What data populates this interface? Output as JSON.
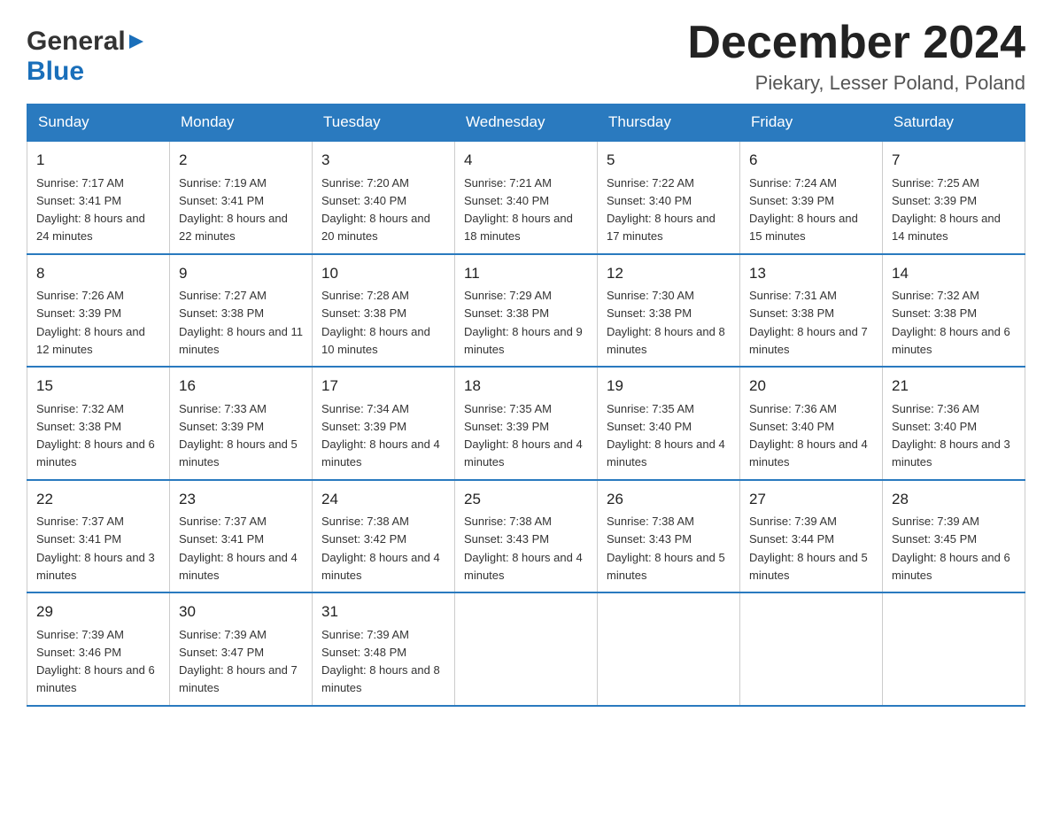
{
  "header": {
    "logo_general": "General",
    "logo_blue": "Blue",
    "month_title": "December 2024",
    "location": "Piekary, Lesser Poland, Poland"
  },
  "days_of_week": [
    "Sunday",
    "Monday",
    "Tuesday",
    "Wednesday",
    "Thursday",
    "Friday",
    "Saturday"
  ],
  "weeks": [
    [
      {
        "day": "1",
        "sunrise": "7:17 AM",
        "sunset": "3:41 PM",
        "daylight": "8 hours and 24 minutes."
      },
      {
        "day": "2",
        "sunrise": "7:19 AM",
        "sunset": "3:41 PM",
        "daylight": "8 hours and 22 minutes."
      },
      {
        "day": "3",
        "sunrise": "7:20 AM",
        "sunset": "3:40 PM",
        "daylight": "8 hours and 20 minutes."
      },
      {
        "day": "4",
        "sunrise": "7:21 AM",
        "sunset": "3:40 PM",
        "daylight": "8 hours and 18 minutes."
      },
      {
        "day": "5",
        "sunrise": "7:22 AM",
        "sunset": "3:40 PM",
        "daylight": "8 hours and 17 minutes."
      },
      {
        "day": "6",
        "sunrise": "7:24 AM",
        "sunset": "3:39 PM",
        "daylight": "8 hours and 15 minutes."
      },
      {
        "day": "7",
        "sunrise": "7:25 AM",
        "sunset": "3:39 PM",
        "daylight": "8 hours and 14 minutes."
      }
    ],
    [
      {
        "day": "8",
        "sunrise": "7:26 AM",
        "sunset": "3:39 PM",
        "daylight": "8 hours and 12 minutes."
      },
      {
        "day": "9",
        "sunrise": "7:27 AM",
        "sunset": "3:38 PM",
        "daylight": "8 hours and 11 minutes."
      },
      {
        "day": "10",
        "sunrise": "7:28 AM",
        "sunset": "3:38 PM",
        "daylight": "8 hours and 10 minutes."
      },
      {
        "day": "11",
        "sunrise": "7:29 AM",
        "sunset": "3:38 PM",
        "daylight": "8 hours and 9 minutes."
      },
      {
        "day": "12",
        "sunrise": "7:30 AM",
        "sunset": "3:38 PM",
        "daylight": "8 hours and 8 minutes."
      },
      {
        "day": "13",
        "sunrise": "7:31 AM",
        "sunset": "3:38 PM",
        "daylight": "8 hours and 7 minutes."
      },
      {
        "day": "14",
        "sunrise": "7:32 AM",
        "sunset": "3:38 PM",
        "daylight": "8 hours and 6 minutes."
      }
    ],
    [
      {
        "day": "15",
        "sunrise": "7:32 AM",
        "sunset": "3:38 PM",
        "daylight": "8 hours and 6 minutes."
      },
      {
        "day": "16",
        "sunrise": "7:33 AM",
        "sunset": "3:39 PM",
        "daylight": "8 hours and 5 minutes."
      },
      {
        "day": "17",
        "sunrise": "7:34 AM",
        "sunset": "3:39 PM",
        "daylight": "8 hours and 4 minutes."
      },
      {
        "day": "18",
        "sunrise": "7:35 AM",
        "sunset": "3:39 PM",
        "daylight": "8 hours and 4 minutes."
      },
      {
        "day": "19",
        "sunrise": "7:35 AM",
        "sunset": "3:40 PM",
        "daylight": "8 hours and 4 minutes."
      },
      {
        "day": "20",
        "sunrise": "7:36 AM",
        "sunset": "3:40 PM",
        "daylight": "8 hours and 4 minutes."
      },
      {
        "day": "21",
        "sunrise": "7:36 AM",
        "sunset": "3:40 PM",
        "daylight": "8 hours and 3 minutes."
      }
    ],
    [
      {
        "day": "22",
        "sunrise": "7:37 AM",
        "sunset": "3:41 PM",
        "daylight": "8 hours and 3 minutes."
      },
      {
        "day": "23",
        "sunrise": "7:37 AM",
        "sunset": "3:41 PM",
        "daylight": "8 hours and 4 minutes."
      },
      {
        "day": "24",
        "sunrise": "7:38 AM",
        "sunset": "3:42 PM",
        "daylight": "8 hours and 4 minutes."
      },
      {
        "day": "25",
        "sunrise": "7:38 AM",
        "sunset": "3:43 PM",
        "daylight": "8 hours and 4 minutes."
      },
      {
        "day": "26",
        "sunrise": "7:38 AM",
        "sunset": "3:43 PM",
        "daylight": "8 hours and 5 minutes."
      },
      {
        "day": "27",
        "sunrise": "7:39 AM",
        "sunset": "3:44 PM",
        "daylight": "8 hours and 5 minutes."
      },
      {
        "day": "28",
        "sunrise": "7:39 AM",
        "sunset": "3:45 PM",
        "daylight": "8 hours and 6 minutes."
      }
    ],
    [
      {
        "day": "29",
        "sunrise": "7:39 AM",
        "sunset": "3:46 PM",
        "daylight": "8 hours and 6 minutes."
      },
      {
        "day": "30",
        "sunrise": "7:39 AM",
        "sunset": "3:47 PM",
        "daylight": "8 hours and 7 minutes."
      },
      {
        "day": "31",
        "sunrise": "7:39 AM",
        "sunset": "3:48 PM",
        "daylight": "8 hours and 8 minutes."
      },
      null,
      null,
      null,
      null
    ]
  ],
  "labels": {
    "sunrise": "Sunrise:",
    "sunset": "Sunset:",
    "daylight": "Daylight:"
  }
}
